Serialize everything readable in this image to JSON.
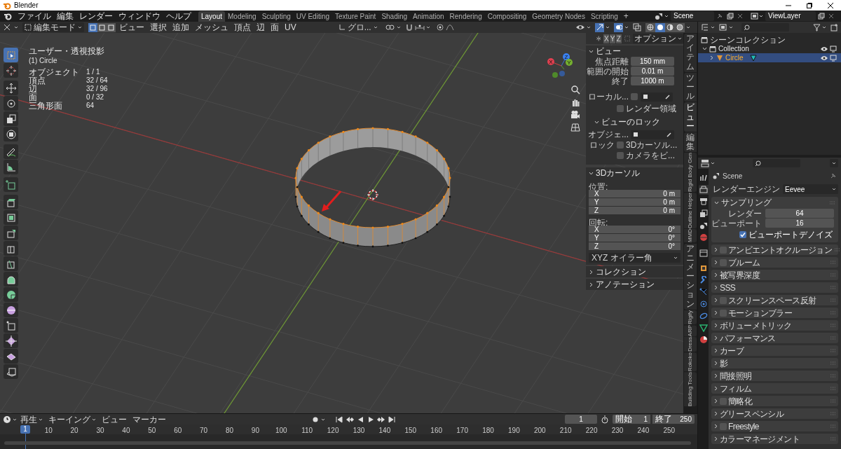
{
  "window": {
    "title": "Blender"
  },
  "menu": [
    "ファイル",
    "編集",
    "レンダー",
    "ウィンドウ",
    "ヘルプ"
  ],
  "workspaces": [
    {
      "label": "Layout",
      "selected": true
    },
    {
      "label": "Modeling",
      "selected": false
    },
    {
      "label": "Sculpting",
      "selected": false
    },
    {
      "label": "UV Editing",
      "selected": false
    },
    {
      "label": "Texture Paint",
      "selected": false
    },
    {
      "label": "Shading",
      "selected": false
    },
    {
      "label": "Animation",
      "selected": false
    },
    {
      "label": "Rendering",
      "selected": false
    },
    {
      "label": "Compositing",
      "selected": false
    },
    {
      "label": "Geometry Nodes",
      "selected": false
    },
    {
      "label": "Scripting",
      "selected": false
    }
  ],
  "add_workspace": "+",
  "scene": {
    "name": "Scene"
  },
  "view_layer": {
    "name": "ViewLayer"
  },
  "viewport_header": {
    "mode": "編集モード",
    "select_modes": [
      {
        "selected": true
      },
      {
        "selected": false
      },
      {
        "selected": false
      }
    ],
    "menus": [
      "ビュー",
      "選択",
      "追加",
      "メッシュ",
      "頂点",
      "辺",
      "面",
      "UV"
    ],
    "orientation": "グロ...",
    "shading_modes": [
      {
        "selected": false
      },
      {
        "selected": true
      },
      {
        "selected": false
      },
      {
        "selected": false
      }
    ]
  },
  "overlay": {
    "view_name": "ユーザー・透視投影",
    "object_name": "(1) Circle",
    "stats": [
      {
        "label": "オブジェクト",
        "value": "1 / 1"
      },
      {
        "label": "頂点",
        "value": "32 / 64"
      },
      {
        "label": "辺",
        "value": "32 / 96"
      },
      {
        "label": "面",
        "value": "0 / 32"
      },
      {
        "label": "三角形面",
        "value": "64"
      }
    ]
  },
  "navigation_gizmo": {
    "axes": [
      "X",
      "Y",
      "Z"
    ]
  },
  "tools": [
    {
      "selected": true
    },
    {
      "selected": false
    },
    {
      "selected": false
    },
    {
      "selected": false
    },
    {
      "selected": false
    },
    {
      "selected": false
    },
    {
      "selected": false
    },
    {
      "selected": false
    },
    {
      "selected": false
    },
    {
      "selected": false
    },
    {
      "selected": false
    },
    {
      "selected": false
    },
    {
      "selected": false
    },
    {
      "selected": false
    },
    {
      "selected": false
    },
    {
      "selected": false
    },
    {
      "selected": false
    },
    {
      "selected": false
    },
    {
      "selected": false
    },
    {
      "selected": false
    },
    {
      "selected": false
    }
  ],
  "sidebar": {
    "axis_buttons": [
      "X",
      "Y",
      "Z"
    ],
    "options": "オプション",
    "view": {
      "title": "ビュー",
      "expanded": true,
      "fields": [
        {
          "label": "焦点距離",
          "value": "150 mm"
        },
        {
          "label": "範囲の開始",
          "value": "0.01 m"
        },
        {
          "label": "終了",
          "value": "1000 m"
        }
      ],
      "local": {
        "label": "ローカル...",
        "checked": false
      },
      "render_region": {
        "label": "レンダー領域",
        "checked": false
      }
    },
    "view_lock": {
      "title": "ビューのロック",
      "expanded": true,
      "object_label": "オブジェ...",
      "lock_label": "ロック",
      "options": [
        {
          "label": "3Dカーソル...",
          "checked": false
        },
        {
          "label": "カメラをビ...",
          "checked": false
        }
      ]
    },
    "cursor": {
      "title": "3Dカーソル",
      "expanded": true,
      "location_label": "位置:",
      "location": [
        {
          "axis": "X",
          "value": "0 m"
        },
        {
          "axis": "Y",
          "value": "0 m"
        },
        {
          "axis": "Z",
          "value": "0 m"
        }
      ],
      "rotation_label": "回転:",
      "rotation": [
        {
          "axis": "X",
          "value": "0°"
        },
        {
          "axis": "Y",
          "value": "0°"
        },
        {
          "axis": "Z",
          "value": "0°"
        }
      ],
      "rotation_mode": "XYZ オイラー角"
    },
    "collapsed_panels": [
      {
        "title": "コレクション",
        "expanded": false
      },
      {
        "title": "アノテーション",
        "expanded": false
      }
    ]
  },
  "sidebar_tabs": [
    {
      "label": "アイテム",
      "kind": "cjk",
      "selected": false
    },
    {
      "label": "ツール",
      "kind": "cjk",
      "selected": false
    },
    {
      "label": "ビュー",
      "kind": "cjk",
      "selected": true
    },
    {
      "label": "編集",
      "kind": "cjk",
      "selected": false
    },
    {
      "label": "Rigid Body Gen",
      "kind": "latin",
      "selected": false
    },
    {
      "label": "Outline Helper",
      "kind": "latin",
      "selected": false
    },
    {
      "label": "MMD",
      "kind": "latin",
      "selected": false
    },
    {
      "label": "アニメーション",
      "kind": "cjk",
      "selected": false
    },
    {
      "label": "Rigify",
      "kind": "latin",
      "selected": false
    },
    {
      "label": "ARP",
      "kind": "latin",
      "selected": false
    },
    {
      "label": "Dress",
      "kind": "latin",
      "selected": false
    },
    {
      "label": "Rokoko",
      "kind": "latin",
      "selected": false
    },
    {
      "label": "Building Tools",
      "kind": "latin",
      "selected": false
    }
  ],
  "outliner": {
    "root": "シーンコレクション",
    "items": [
      {
        "label": "Collection",
        "expanded": true,
        "selected": false,
        "children": [
          {
            "label": "Circle",
            "expanded": false,
            "selected": true
          }
        ]
      }
    ]
  },
  "properties": {
    "tabs": [
      {
        "selected": false
      },
      {
        "selected": true
      },
      {
        "selected": false
      },
      {
        "selected": false
      },
      {
        "selected": false
      },
      {
        "selected": false
      },
      {
        "selected": false
      },
      {
        "selected": false
      },
      {
        "selected": false
      },
      {
        "selected": false
      },
      {
        "selected": false
      },
      {
        "selected": false
      },
      {
        "selected": false
      },
      {
        "selected": false
      }
    ],
    "context": "Scene",
    "render_engine": {
      "label": "レンダーエンジン",
      "value": "Eevee"
    },
    "sampling": {
      "title": "サンプリング",
      "expanded": true,
      "fields": [
        {
          "label": "レンダー",
          "value": "64"
        },
        {
          "label": "ビューポート",
          "value": "16"
        }
      ],
      "denoise": {
        "label": "ビューポートデノイズ",
        "checked": true
      }
    },
    "panels": [
      {
        "title": "アンビエントオクルージョン",
        "kind": "toggle",
        "checked": false
      },
      {
        "title": "ブルーム",
        "kind": "toggle",
        "checked": false
      },
      {
        "title": "被写界深度",
        "kind": "plain"
      },
      {
        "title": "SSS",
        "kind": "plain"
      },
      {
        "title": "スクリーンスペース反射",
        "kind": "toggle",
        "checked": false
      },
      {
        "title": "モーションブラー",
        "kind": "toggle",
        "checked": false
      },
      {
        "title": "ボリューメトリック",
        "kind": "plain"
      },
      {
        "title": "パフォーマンス",
        "kind": "plain"
      },
      {
        "title": "カーブ",
        "kind": "plain"
      },
      {
        "title": "影",
        "kind": "plain"
      },
      {
        "title": "間接照明",
        "kind": "plain"
      },
      {
        "title": "フィルム",
        "kind": "plain"
      },
      {
        "title": "簡略化",
        "kind": "toggle",
        "checked": false
      },
      {
        "title": "グリースペンシル",
        "kind": "plain"
      },
      {
        "title": "Freestyle",
        "kind": "toggle",
        "checked": false
      },
      {
        "title": "カラーマネージメント",
        "kind": "plain"
      }
    ]
  },
  "timeline": {
    "menus": [
      "再生",
      "キーイング",
      "ビュー",
      "マーカー"
    ],
    "current_frame": "1",
    "start_label": "開始",
    "start": "1",
    "end_label": "終了",
    "end": "250",
    "playhead": "1",
    "ruler": [
      "10",
      "20",
      "30",
      "40",
      "50",
      "60",
      "70",
      "80",
      "90",
      "100",
      "110",
      "120",
      "130",
      "140",
      "150",
      "160",
      "170",
      "180",
      "190",
      "200",
      "210",
      "220",
      "230",
      "240",
      "250"
    ]
  }
}
